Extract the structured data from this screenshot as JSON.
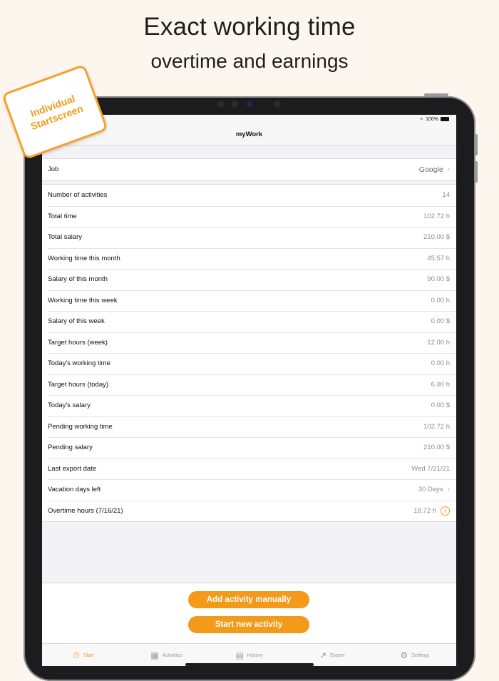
{
  "promo": {
    "headline": "Exact working time",
    "subheadline": "overtime and earnings",
    "badge_line1": "Individual",
    "badge_line2": "Startscreen"
  },
  "status": {
    "battery": "100%"
  },
  "nav": {
    "title": "myWork"
  },
  "job": {
    "label": "Job",
    "value": "Google"
  },
  "stats": [
    {
      "label": "Number of activities",
      "value": "14"
    },
    {
      "label": "Total time",
      "value": "102.72 h"
    },
    {
      "label": "Total salary",
      "value": "210.00 $"
    },
    {
      "label": "Working time this month",
      "value": "45.57 h"
    },
    {
      "label": "Salary of this month",
      "value": "90.00 $"
    },
    {
      "label": "Working time this week",
      "value": "0.00 h"
    },
    {
      "label": "Salary of this week",
      "value": "0.00 $"
    },
    {
      "label": "Target hours (week)",
      "value": "12.00 h"
    },
    {
      "label": "Today's working time",
      "value": "0.00 h"
    },
    {
      "label": "Target hours (today)",
      "value": "6.00 h"
    },
    {
      "label": "Today's salary",
      "value": "0.00 $"
    },
    {
      "label": "Pending working time",
      "value": "102.72 h"
    },
    {
      "label": "Pending salary",
      "value": "210.00 $"
    },
    {
      "label": "Last export date",
      "value": "Wed 7/21/21"
    },
    {
      "label": "Vacation days left",
      "value": "30 Days"
    },
    {
      "label": "Overtime hours (7/16/21)",
      "value": "18.72 h"
    }
  ],
  "actions": {
    "add_manual": "Add activity manually",
    "start_new": "Start new activity"
  },
  "tabs": [
    {
      "label": "Start",
      "icon": "stopwatch-icon"
    },
    {
      "label": "Activities",
      "icon": "activities-icon"
    },
    {
      "label": "History",
      "icon": "calendar-icon"
    },
    {
      "label": "Export",
      "icon": "export-icon"
    },
    {
      "label": "Settings",
      "icon": "gear-icon"
    }
  ],
  "colors": {
    "accent": "#f39a1a",
    "background": "#fdf6ee",
    "screen_bg": "#f2f2f7"
  }
}
